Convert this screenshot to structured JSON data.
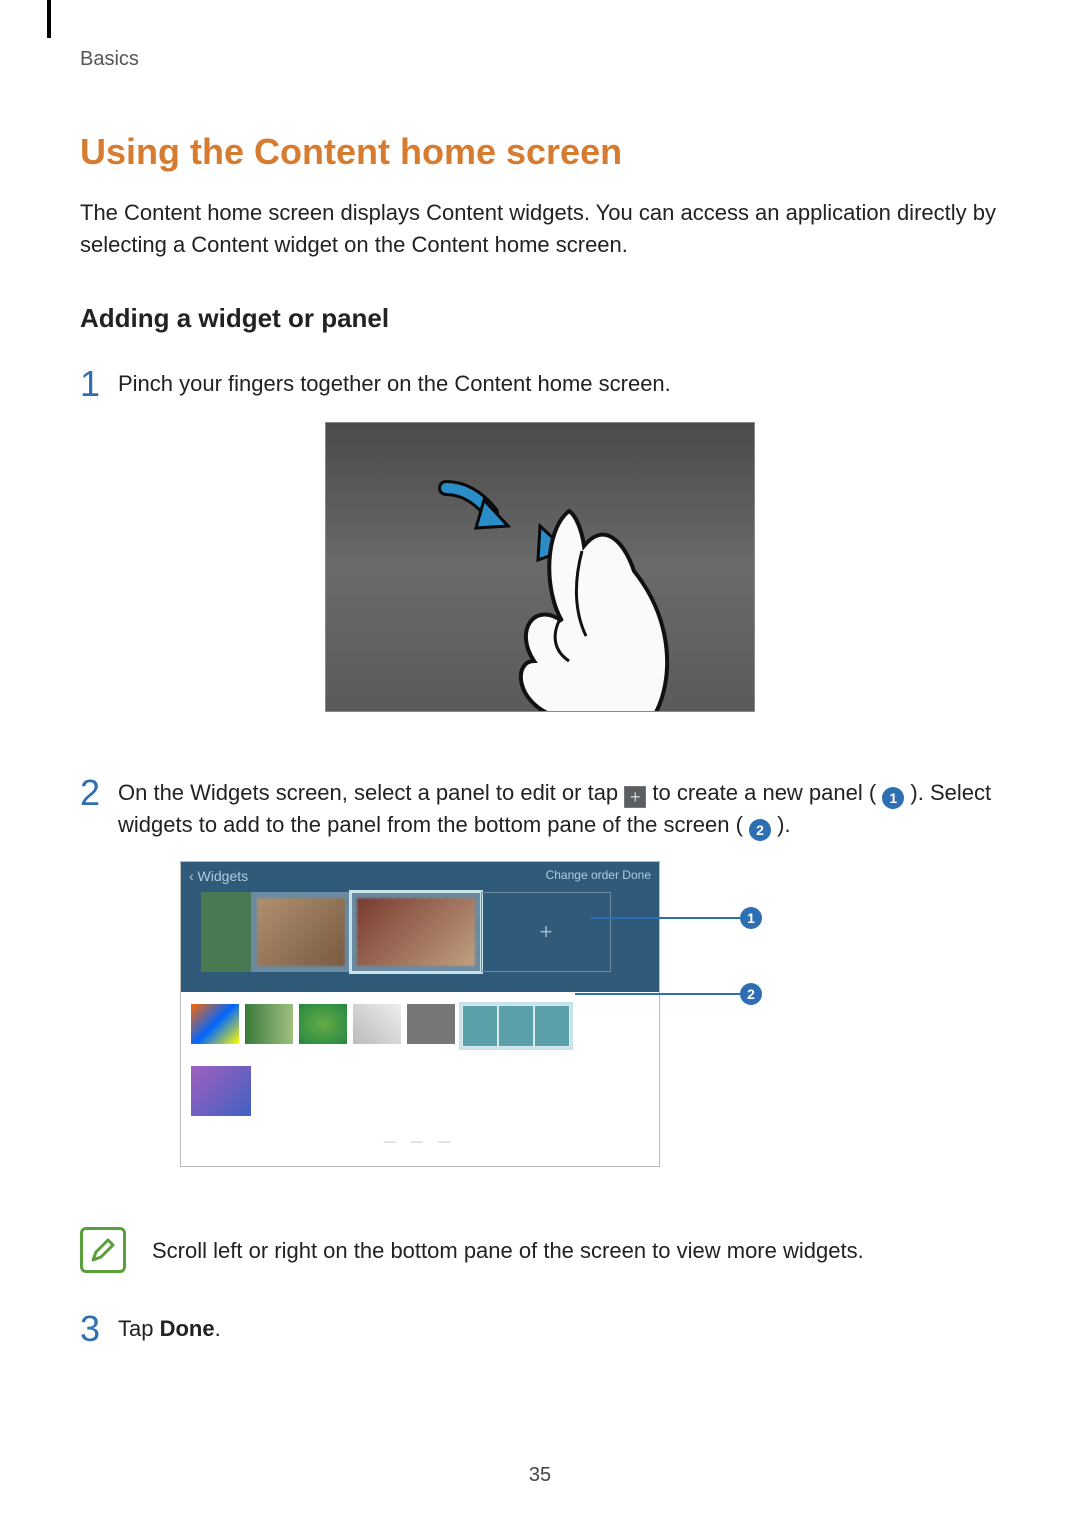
{
  "breadcrumb": "Basics",
  "heading": "Using the Content home screen",
  "intro": "The Content home screen displays Content widgets. You can access an application directly by selecting a Content widget on the Content home screen.",
  "sub_heading": "Adding a widget or panel",
  "steps": {
    "s1_num": "1",
    "s1_text": "Pinch your fingers together on the Content home screen.",
    "s2_num": "2",
    "s2_pre": "On the Widgets screen, select a panel to edit or tap ",
    "s2_mid": " to create a new panel ( ",
    "s2_c1": "1",
    "s2_mid2": " ). Select widgets to add to the panel from the bottom pane of the screen ( ",
    "s2_c2": "2",
    "s2_end": " ).",
    "s3_num": "3",
    "s3_pre": "Tap ",
    "s3_bold": "Done",
    "s3_end": "."
  },
  "callouts": {
    "c1": "1",
    "c2": "2"
  },
  "widgets_header": {
    "back": "‹  Widgets",
    "right": "Change order    Done"
  },
  "plus_glyph": "+",
  "note_text": "Scroll left or right on the bottom pane of the screen to view more widgets.",
  "page_number": "35"
}
